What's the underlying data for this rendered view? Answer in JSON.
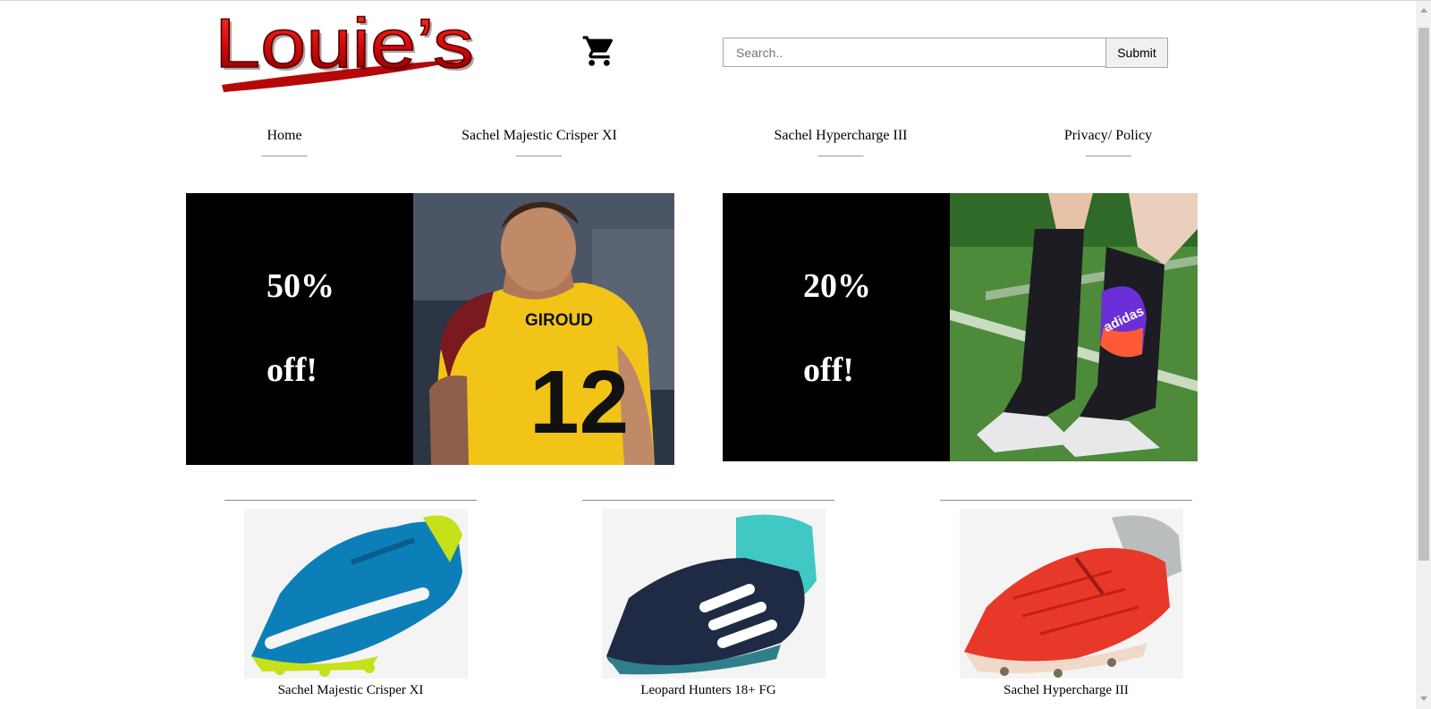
{
  "brand": {
    "logo_text": "Louie’s"
  },
  "header": {
    "cart_icon": "shopping-cart-icon",
    "search_placeholder": "Search..",
    "submit_label": "Submit"
  },
  "nav": [
    {
      "label": "Home"
    },
    {
      "label": "Sachel Majestic Crisper XI"
    },
    {
      "label": "Sachel Hypercharge III"
    },
    {
      "label": "Privacy/ Policy"
    }
  ],
  "promos": [
    {
      "line1": "50%",
      "line2": "off!",
      "photo": "player-yellow-jersey-photo",
      "jersey_name": "GIROUD",
      "jersey_number": "12"
    },
    {
      "line1": "20%",
      "line2": "off!",
      "photo": "shin-guard-sock-photo",
      "brand_mark": "adidas"
    }
  ],
  "products": [
    {
      "name": "Sachel Majestic Crisper XI",
      "color": "#0d7fb8",
      "accent": "#c6e01a"
    },
    {
      "name": "Leopard Hunters 18+ FG",
      "color": "#1f2a44",
      "accent": "#3fc8c4"
    },
    {
      "name": "Sachel Hypercharge III",
      "color": "#e8382a",
      "accent": "#b9bdbd"
    }
  ],
  "colors": {
    "logo_red": "#d10c0c",
    "promo_bg": "#000000"
  }
}
